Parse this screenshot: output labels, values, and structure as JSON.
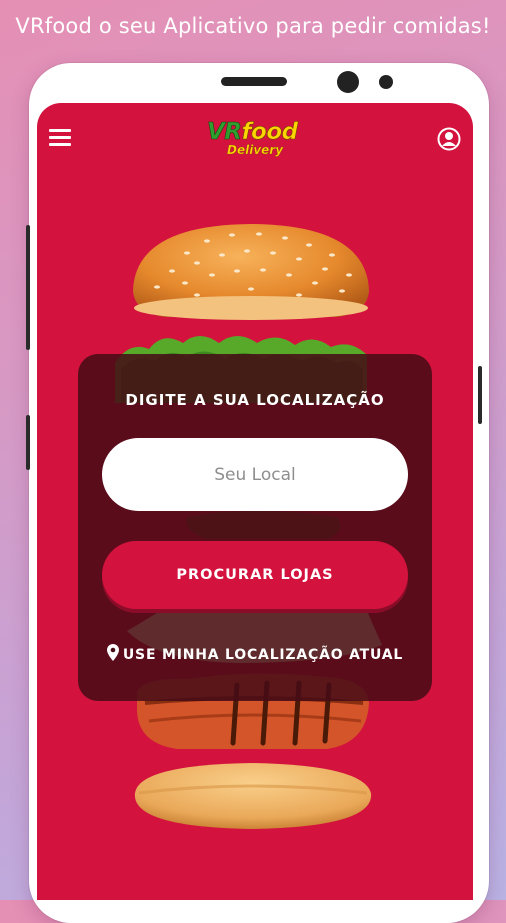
{
  "promo": {
    "headline": "VRfood o seu Aplicativo para pedir comidas!"
  },
  "header": {
    "menu_icon": "hamburger-menu-icon",
    "logo_brand_vr": "VR",
    "logo_brand_food": "food",
    "logo_sub": "Delivery",
    "user_icon": "user-profile-icon"
  },
  "location_card": {
    "title": "DIGITE A SUA LOCALIZAÇÃO",
    "input_value": "",
    "input_placeholder": "Seu Local",
    "search_button": "PROCURAR LOJAS",
    "use_location_icon": "map-pin-icon",
    "use_location": "USE MINHA LOCALIZAÇÃO ATUAL"
  },
  "colors": {
    "brand_red": "#d4123e",
    "card_overlay": "#460c16",
    "logo_green": "#2fa02f",
    "logo_yellow": "#ffd400"
  }
}
